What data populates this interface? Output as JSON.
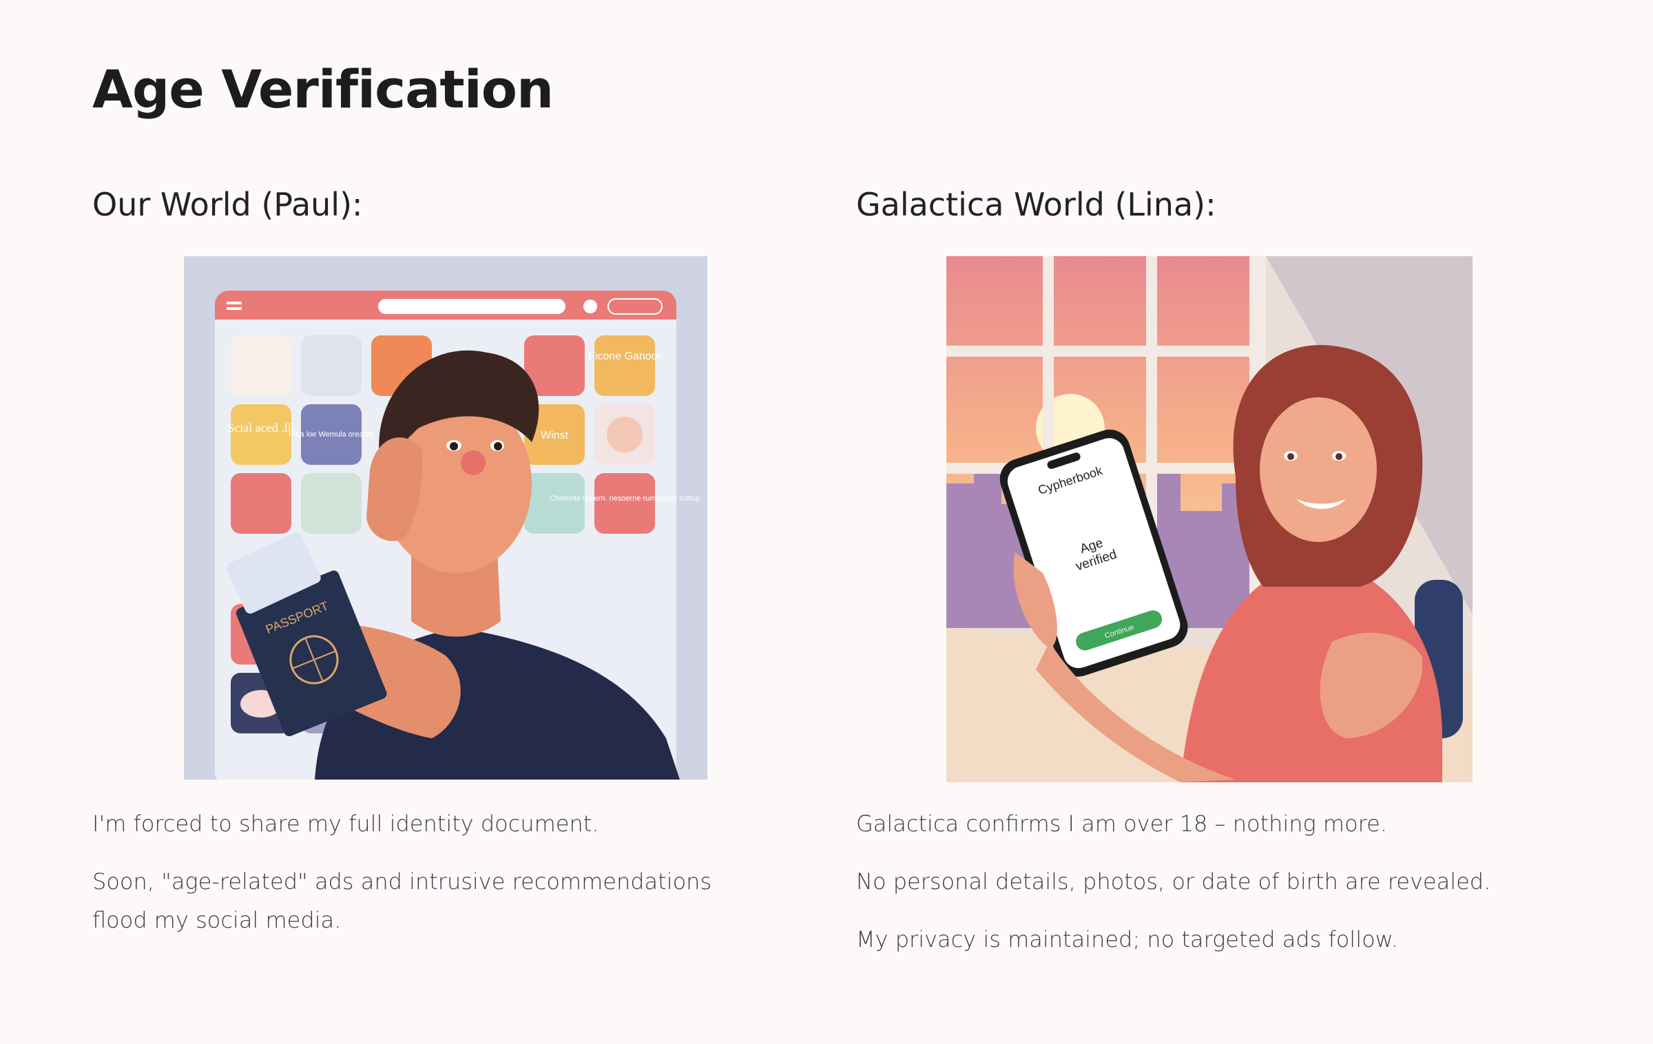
{
  "page": {
    "title": "Age Verification"
  },
  "left": {
    "heading": "Our World (Paul):",
    "image_alt": "Illustration of a worried man holding a passport in front of a social media page",
    "image_text": {
      "tile_a": "Ficone Ganoor",
      "tile_b": "Scial aced .lll",
      "tile_c": "Hiba loe Wemula oreatab",
      "tile_d": "Winst",
      "tile_e": "Choronte lesiern. nesoerne rumepadir suttup",
      "passport": "PASSPORT"
    },
    "paragraphs": [
      "I'm forced to share my full identity document.",
      "Soon, \"age-related\" ads and intrusive recommendations flood my social media."
    ]
  },
  "right": {
    "heading": "Galactica World (Lina):",
    "image_alt": "Illustration of a smiling woman holding a phone showing age verified",
    "image_text": {
      "app_name": "Cypherbook",
      "status_line1": "Age",
      "status_line2": "verified",
      "button": "Continue"
    },
    "paragraphs": [
      "Galactica confirms I am over 18 – nothing more.",
      "No personal details, photos, or date of birth are revealed.",
      "My privacy is maintained; no targeted ads follow."
    ]
  },
  "colors": {
    "background": "#fdf9f8",
    "title": "#1d1d1d",
    "body_text": "#3c3c3c",
    "accent_coral": "#ea7a78",
    "accent_green": "#3fa65a"
  }
}
